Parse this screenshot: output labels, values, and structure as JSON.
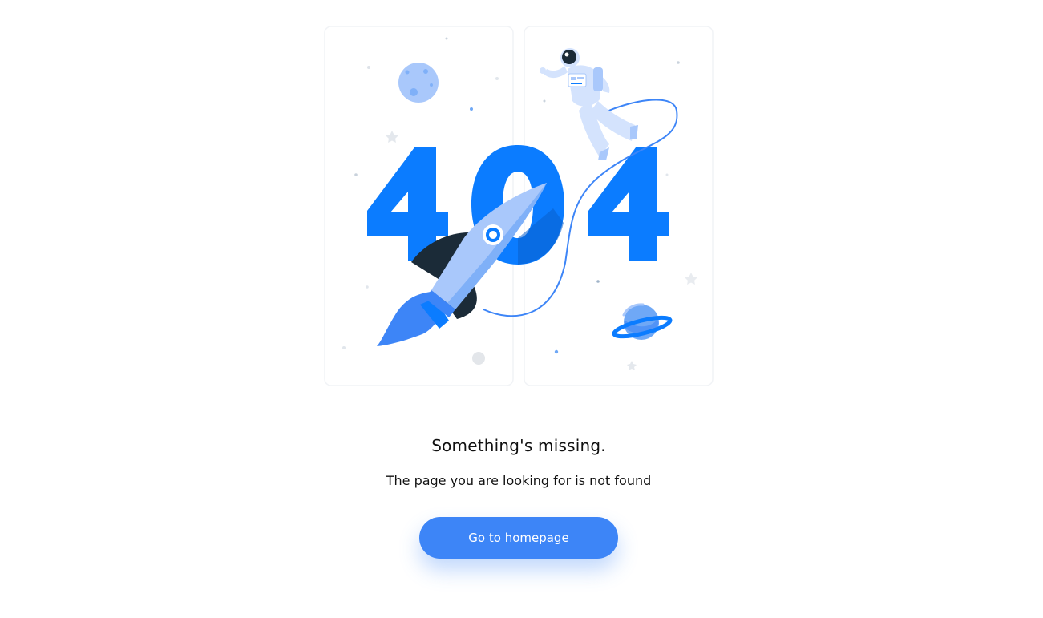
{
  "illustration": {
    "big_text": "404",
    "colors": {
      "primary": "#0b7cff",
      "light": "#a9c8fb",
      "pale": "#d4e3fd",
      "dark": "#1b2b38",
      "panel_border": "#f1f3f6"
    }
  },
  "content": {
    "headline": "Something's missing.",
    "subline": "The page you are looking for is not found"
  },
  "actions": {
    "home_button_label": "Go to homepage"
  }
}
